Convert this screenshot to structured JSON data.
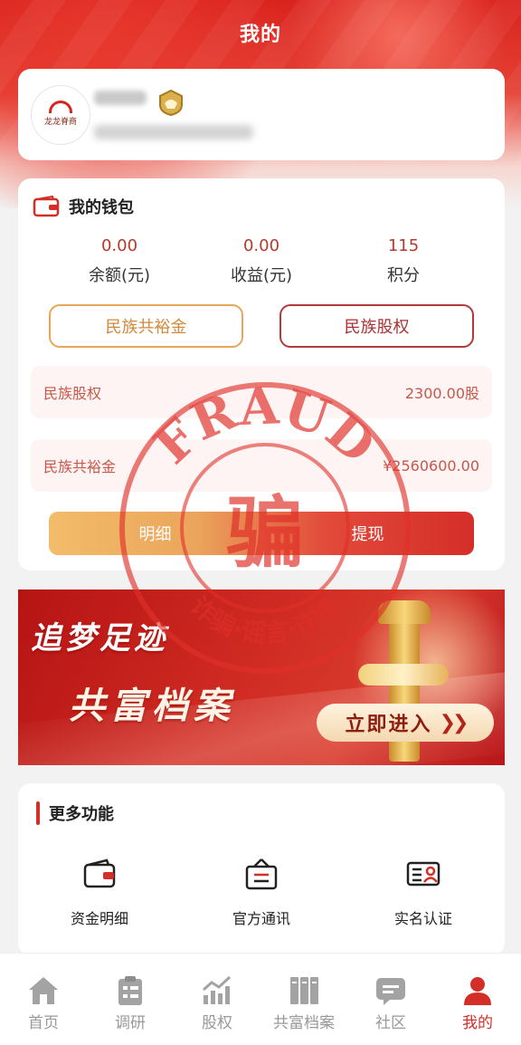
{
  "header": {
    "title": "我的"
  },
  "profile": {
    "avatar_text": "龙龙脊商"
  },
  "wallet": {
    "title": "我的钱包",
    "stats": [
      {
        "value": "0.00",
        "label": "余额(元)"
      },
      {
        "value": "0.00",
        "label": "收益(元)"
      },
      {
        "value": "115",
        "label": "积分"
      }
    ],
    "buttons": {
      "left": "民族共裕金",
      "right": "民族股权"
    },
    "rows": [
      {
        "label": "民族股权",
        "value": "2300.00股"
      },
      {
        "label": "民族共裕金",
        "value": "¥2560600.00"
      }
    ],
    "actions": {
      "detail": "明细",
      "withdraw": "提现"
    }
  },
  "banner": {
    "line1": "追梦足迹",
    "line2": "共富档案",
    "enter_label": "立即进入"
  },
  "more": {
    "title": "更多功能",
    "items": [
      {
        "label": "资金明细",
        "icon": "wallet-icon"
      },
      {
        "label": "官方通讯",
        "icon": "notice-board-icon"
      },
      {
        "label": "实名认证",
        "icon": "id-card-icon"
      }
    ]
  },
  "tabs": [
    {
      "label": "首页",
      "icon": "home-icon"
    },
    {
      "label": "调研",
      "icon": "clipboard-icon"
    },
    {
      "label": "股权",
      "icon": "trend-chart-icon"
    },
    {
      "label": "共富档案",
      "icon": "archive-icon"
    },
    {
      "label": "社区",
      "icon": "chat-icon"
    },
    {
      "label": "我的",
      "icon": "user-icon"
    }
  ],
  "stamp": {
    "top_text": "FRAUD",
    "center_char": "骗",
    "bottom_text": "诈骗·谣言·诈骗"
  },
  "colors": {
    "primary": "#d42e28",
    "gold": "#e6a75a",
    "gray": "#999999"
  }
}
